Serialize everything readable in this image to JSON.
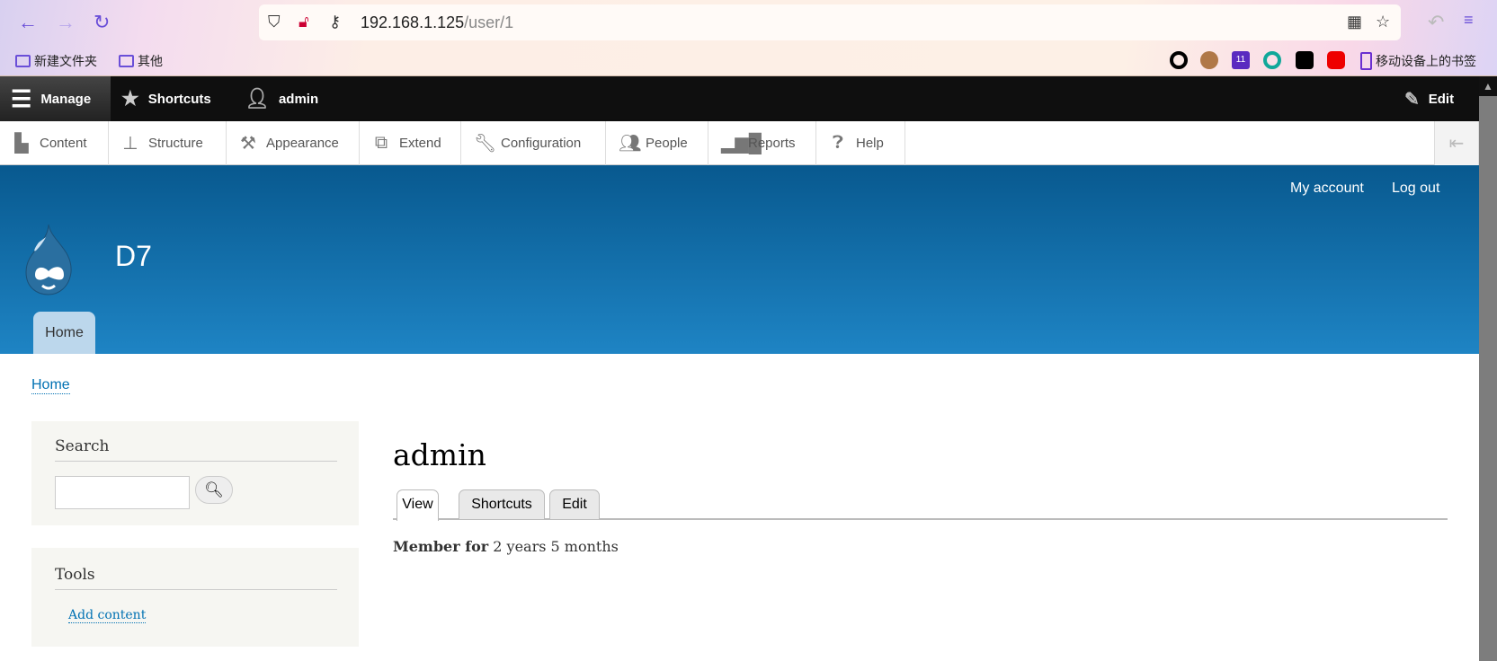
{
  "browser": {
    "url_host": "192.168.1.125",
    "url_path": "/user/1",
    "bookmarks": [
      {
        "label": "新建文件夹"
      },
      {
        "label": "其他"
      }
    ],
    "mobile_bookmarks": "移动设备上的书签",
    "badge_count": "11"
  },
  "toolbar": {
    "manage": "Manage",
    "shortcuts": "Shortcuts",
    "user": "admin",
    "edit": "Edit"
  },
  "tray": {
    "items": [
      {
        "label": "Content",
        "icon": "file-icon"
      },
      {
        "label": "Structure",
        "icon": "sitemap-icon"
      },
      {
        "label": "Appearance",
        "icon": "paintbrush-icon"
      },
      {
        "label": "Extend",
        "icon": "puzzle-icon"
      },
      {
        "label": "Configuration",
        "icon": "wrench-icon"
      },
      {
        "label": "People",
        "icon": "people-icon"
      },
      {
        "label": "Reports",
        "icon": "bar-chart-icon"
      },
      {
        "label": "Help",
        "icon": "help-icon"
      }
    ]
  },
  "header": {
    "my_account": "My account",
    "log_out": "Log out",
    "site_name": "D7",
    "home_tab": "Home"
  },
  "breadcrumb": "Home",
  "sidebar": {
    "search_title": "Search",
    "search_value": "",
    "tools_title": "Tools",
    "add_content": "Add content"
  },
  "main": {
    "title": "admin",
    "tabs": [
      {
        "label": "View",
        "active": true
      },
      {
        "label": "Shortcuts"
      },
      {
        "label": "Edit"
      }
    ],
    "member_label": "Member for",
    "member_value": "2 years 5 months"
  },
  "colors": {
    "header_top": "#08598f",
    "header_bottom": "#1e84c4",
    "link": "#0071b3",
    "toolbar": "#0f0f0f"
  }
}
